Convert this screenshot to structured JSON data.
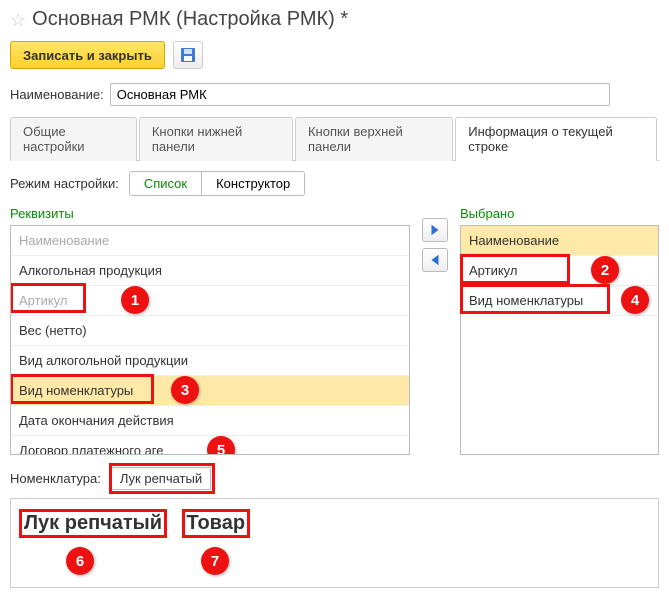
{
  "header": {
    "title": "Основная РМК (Настройка РМК) *",
    "save_close_label": "Записать и закрыть"
  },
  "name_field": {
    "label": "Наименование:",
    "value": "Основная РМК"
  },
  "tabs": [
    {
      "label": "Общие настройки"
    },
    {
      "label": "Кнопки нижней панели"
    },
    {
      "label": "Кнопки верхней панели"
    },
    {
      "label": "Информация о текущей строке"
    }
  ],
  "mode": {
    "label": "Режим настройки:",
    "list_label": "Список",
    "constructor_label": "Конструктор"
  },
  "left_column": {
    "title": "Реквизиты",
    "items": [
      {
        "label": "Наименование",
        "disabled": true
      },
      {
        "label": "Алкогольная продукция"
      },
      {
        "label": "Артикул",
        "disabled": true
      },
      {
        "label": "Вес (нетто)"
      },
      {
        "label": "Вид алкогольной продукции"
      },
      {
        "label": "Вид номенклатуры",
        "selected": true
      },
      {
        "label": "Дата окончания действия"
      },
      {
        "label": "Договор платежного аге"
      }
    ]
  },
  "right_column": {
    "title": "Выбрано",
    "items": [
      {
        "label": "Наименование",
        "hl": true
      },
      {
        "label": "Артикул"
      },
      {
        "label": "Вид номенклатуры"
      }
    ]
  },
  "nomenclature": {
    "label": "Номенклатура:",
    "value": "Лук репчатый"
  },
  "preview": {
    "text1": "Лук репчатый",
    "text2": "Товар"
  },
  "markers": {
    "m1": "1",
    "m2": "2",
    "m3": "3",
    "m4": "4",
    "m5": "5",
    "m6": "6",
    "m7": "7"
  }
}
